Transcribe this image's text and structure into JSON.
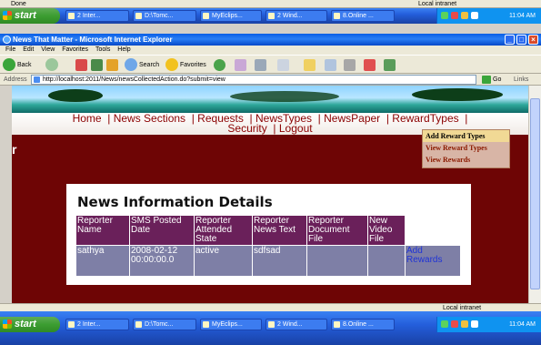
{
  "top_status": {
    "text": "Done",
    "zone": "Local intranet"
  },
  "taskbar": {
    "start": "start",
    "tasks": [
      "2 Inter...",
      "D:\\Tomc...",
      "MyEclips...",
      "2 Wind...",
      "8.Online ..."
    ],
    "clock": "11:04 AM"
  },
  "window": {
    "title": "News That Matter - Microsoft Internet Explorer",
    "menu": [
      "File",
      "Edit",
      "View",
      "Favorites",
      "Tools",
      "Help"
    ],
    "toolbar": {
      "back": "Back",
      "search": "Search",
      "favorites": "Favorites"
    },
    "address": {
      "label": "Address",
      "url": "http://localhost:2011/News/newsCollectedAction.do?submit=view",
      "go": "Go",
      "links": "Links"
    }
  },
  "page": {
    "nav_row1": "Home  | News Sections  | Requests  | NewsTypes  | NewsPaper  | RewardTypes  |",
    "nav_row2": "Security  | Logout",
    "dropdown": [
      "Add Reward Types",
      "View Reward Types",
      "View Rewards"
    ],
    "side_letter": "r",
    "heading": "News Information Details",
    "table": {
      "headers": [
        "Reporter Name",
        "SMS Posted Date",
        "Reporter Attended State",
        "Reporter News Text",
        "Reporter Document File",
        "New Video File",
        ""
      ],
      "row": [
        "sathya",
        "2008-02-12 00:00:00.0",
        "active",
        "sdfsad",
        "",
        "",
        "Add Rewards"
      ]
    }
  },
  "bottom_status": {
    "text": "",
    "zone": "Local intranet"
  },
  "colors": {
    "page_bg": "#6e0505",
    "header_cell": "#6a205a",
    "data_cell": "#7e7fa6",
    "nav_text": "#8b0000"
  }
}
